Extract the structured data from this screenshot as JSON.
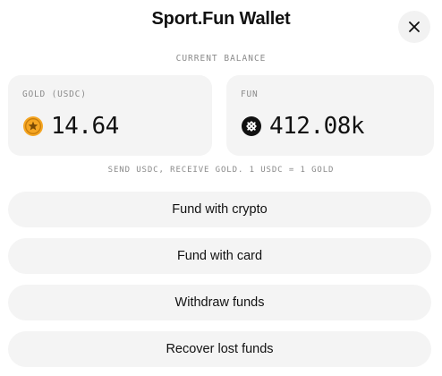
{
  "header": {
    "title": "Sport.Fun Wallet"
  },
  "balance": {
    "label": "CURRENT BALANCE",
    "gold": {
      "label": "GOLD (USDC)",
      "value": "14.64",
      "icon": "gold-coin-icon",
      "color": "#f5a623"
    },
    "fun": {
      "label": "FUN",
      "value": "412.08k",
      "icon": "fun-token-icon",
      "color": "#111111"
    },
    "note": "SEND USDC, RECEIVE GOLD. 1 USDC = 1 GOLD"
  },
  "actions": {
    "fund_crypto": "Fund with crypto",
    "fund_card": "Fund with card",
    "withdraw": "Withdraw funds",
    "recover": "Recover lost funds"
  }
}
